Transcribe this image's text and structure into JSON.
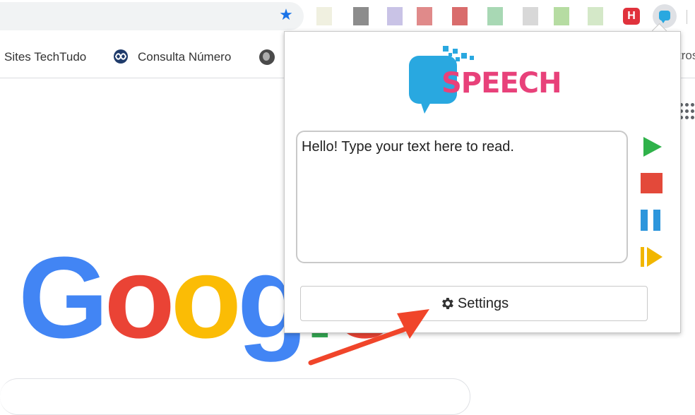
{
  "bookmarks": {
    "item1": "Sites TechTudo",
    "item2": "Consulta Número",
    "overflow_partial": "tros"
  },
  "popup": {
    "logo_text": "SPEECH",
    "textarea_value": "Hello! Type your text here to read.",
    "settings_label": "Settings"
  },
  "toolbar": {
    "ext_h_label": "H"
  },
  "page": {
    "logo_letters": [
      "G",
      "o",
      "o",
      "g",
      "l",
      "e"
    ]
  },
  "colors": {
    "speech_blue": "#29a8e0",
    "speech_pink": "#e8417a",
    "play_green": "#2fb24a",
    "stop_red": "#e3493a",
    "pause_blue": "#2d96dc",
    "resume_yellow": "#f1b600",
    "arrow_red": "#f0452a",
    "google_blue": "#4285f4",
    "google_red": "#ea4335",
    "google_yellow": "#fbbc05",
    "google_green": "#34a853"
  },
  "icons": [
    "star-icon",
    "speech-extension-icon",
    "globe-icon",
    "apps-grid-icon",
    "play-icon",
    "stop-icon",
    "pause-icon",
    "resume-icon",
    "gear-icon"
  ]
}
